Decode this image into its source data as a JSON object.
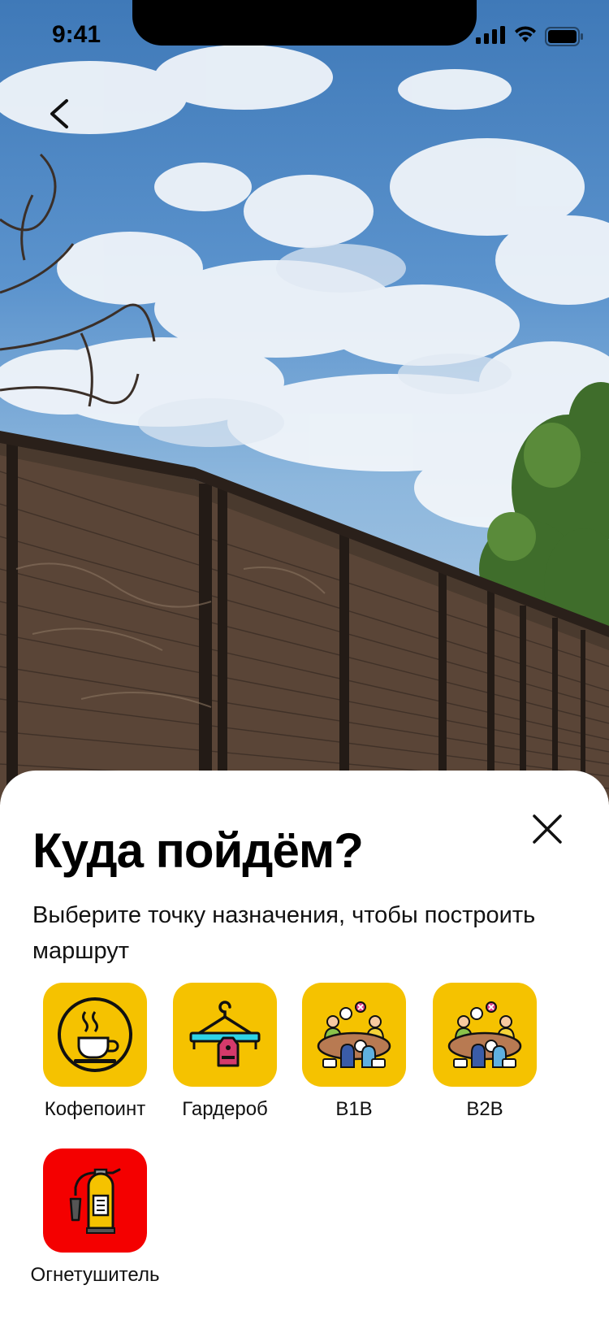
{
  "status_bar": {
    "time": "9:41"
  },
  "sheet": {
    "title": "Куда пойдём?",
    "subtitle": "Выберите точку назначения, чтобы построить маршрут",
    "destinations": [
      {
        "label": "Кофепоинт",
        "icon": "coffee-cup-icon",
        "color": "#f5c200"
      },
      {
        "label": "Гардероб",
        "icon": "hanger-icon",
        "color": "#f5c200"
      },
      {
        "label": "B1B",
        "icon": "meeting-table-icon",
        "color": "#f5c200"
      },
      {
        "label": "B2B",
        "icon": "meeting-table-icon",
        "color": "#f5c200"
      },
      {
        "label": "Огнетушитель",
        "icon": "fire-extinguisher-icon",
        "color": "#f40000"
      }
    ]
  }
}
